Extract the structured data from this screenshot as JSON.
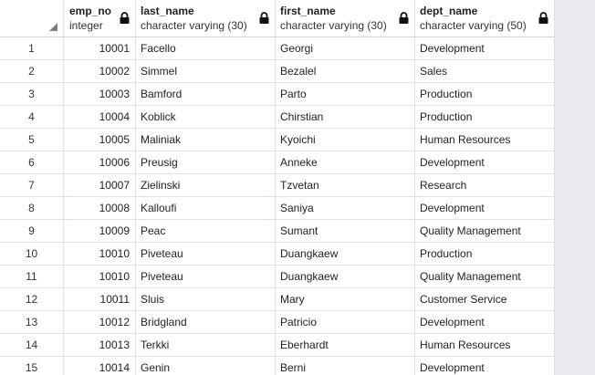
{
  "columns": [
    {
      "name": "emp_no",
      "type": "integer"
    },
    {
      "name": "last_name",
      "type": "character varying (30)"
    },
    {
      "name": "first_name",
      "type": "character varying (30)"
    },
    {
      "name": "dept_name",
      "type": "character varying (50)"
    }
  ],
  "rows": [
    {
      "n": "1",
      "emp_no": "10001",
      "last_name": "Facello",
      "first_name": "Georgi",
      "dept_name": "Development"
    },
    {
      "n": "2",
      "emp_no": "10002",
      "last_name": "Simmel",
      "first_name": "Bezalel",
      "dept_name": "Sales"
    },
    {
      "n": "3",
      "emp_no": "10003",
      "last_name": "Bamford",
      "first_name": "Parto",
      "dept_name": "Production"
    },
    {
      "n": "4",
      "emp_no": "10004",
      "last_name": "Koblick",
      "first_name": "Chirstian",
      "dept_name": "Production"
    },
    {
      "n": "5",
      "emp_no": "10005",
      "last_name": "Maliniak",
      "first_name": "Kyoichi",
      "dept_name": "Human Resources"
    },
    {
      "n": "6",
      "emp_no": "10006",
      "last_name": "Preusig",
      "first_name": "Anneke",
      "dept_name": "Development"
    },
    {
      "n": "7",
      "emp_no": "10007",
      "last_name": "Zielinski",
      "first_name": "Tzvetan",
      "dept_name": "Research"
    },
    {
      "n": "8",
      "emp_no": "10008",
      "last_name": "Kalloufi",
      "first_name": "Saniya",
      "dept_name": "Development"
    },
    {
      "n": "9",
      "emp_no": "10009",
      "last_name": "Peac",
      "first_name": "Sumant",
      "dept_name": "Quality Management"
    },
    {
      "n": "10",
      "emp_no": "10010",
      "last_name": "Piveteau",
      "first_name": "Duangkaew",
      "dept_name": "Production"
    },
    {
      "n": "11",
      "emp_no": "10010",
      "last_name": "Piveteau",
      "first_name": "Duangkaew",
      "dept_name": "Quality Management"
    },
    {
      "n": "12",
      "emp_no": "10011",
      "last_name": "Sluis",
      "first_name": "Mary",
      "dept_name": "Customer Service"
    },
    {
      "n": "13",
      "emp_no": "10012",
      "last_name": "Bridgland",
      "first_name": "Patricio",
      "dept_name": "Development"
    },
    {
      "n": "14",
      "emp_no": "10013",
      "last_name": "Terkki",
      "first_name": "Eberhardt",
      "dept_name": "Human Resources"
    },
    {
      "n": "15",
      "emp_no": "10014",
      "last_name": "Genin",
      "first_name": "Berni",
      "dept_name": "Development"
    }
  ]
}
